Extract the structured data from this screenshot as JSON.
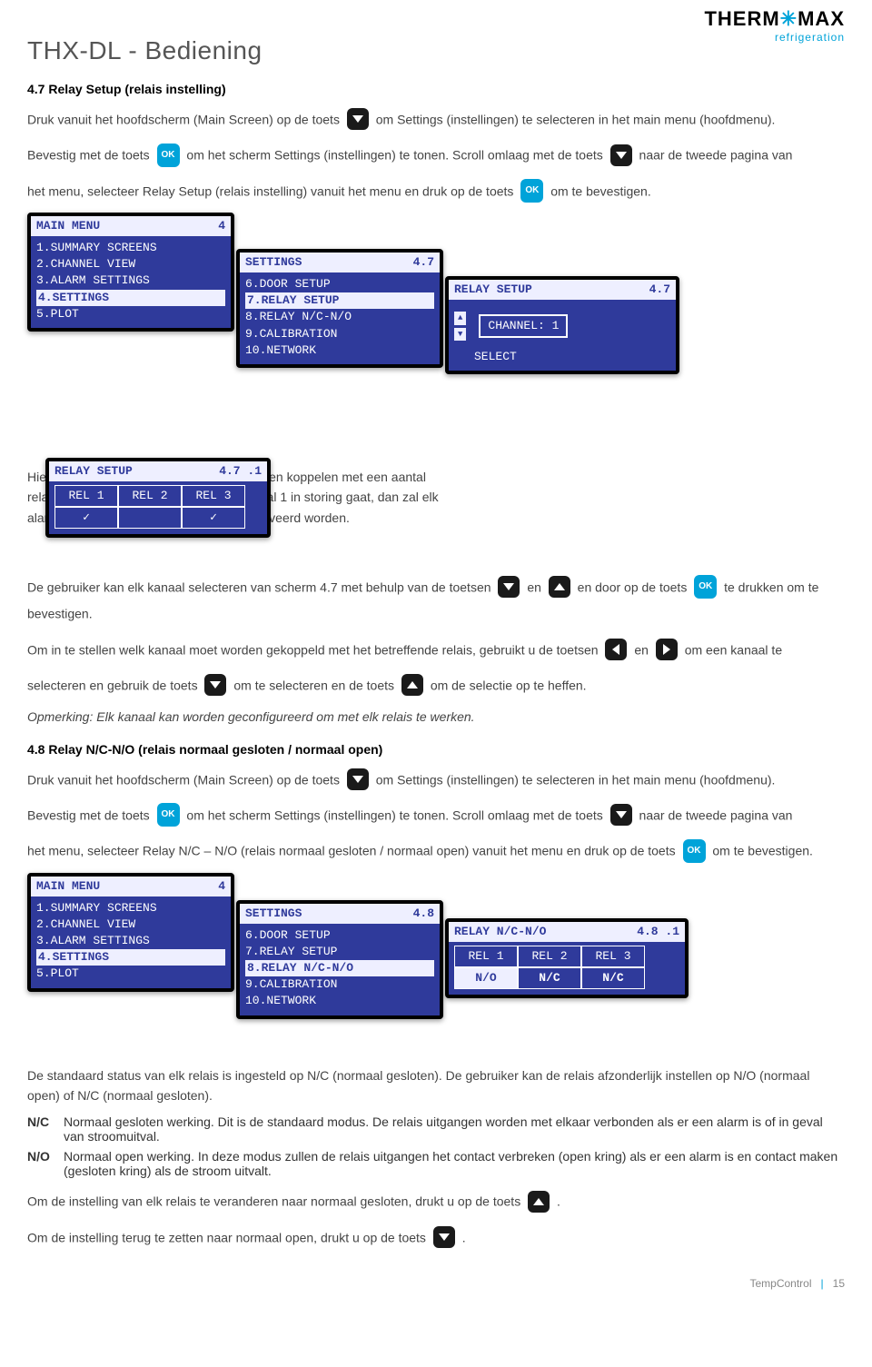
{
  "brand": {
    "name_a": "THERM",
    "name_b": "MAX",
    "sub": "refrigeration"
  },
  "page_title": "THX-DL - Bediening",
  "s47": {
    "heading": "4.7  Relay Setup (relais instelling)",
    "l1a": "Druk vanuit het hoofdscherm (Main Screen) op de toets",
    "l1b": "om Settings (instellingen) te selecteren in het main menu (hoofdmenu).",
    "l2a": "Bevestig met de toets",
    "l2b": "om het scherm Settings (instellingen) te tonen. Scroll omlaag met de toets",
    "l2c": "naar de tweede pagina van",
    "l3a": "het menu, selecteer Relay Setup (relais instelling) vanuit het menu en druk op de toets",
    "l3b": "om te bevestigen.",
    "koppel": "Hiermee kan de gebruiker elk van de kanalen koppelen met een aantal relais uitgangen, bijv. alarmrelais. Als kanaal 1 in storing gaat, dan zal elk alarm dat is gekoppeld met kanaal 1 geactiveerd worden.",
    "p4a": "De gebruiker kan elk kanaal selecteren van scherm 4.7 met behulp van de toetsen",
    "p4b": "en",
    "p4c": "en door op de toets",
    "p4d": "te drukken om te bevestigen.",
    "p5a": "Om in te stellen welk kanaal moet worden gekoppeld met het betreffende relais, gebruikt u de toetsen",
    "p5b": "en",
    "p5c": "om een kanaal te",
    "p6a": "selecteren en gebruik de toets",
    "p6b": "om te selecteren en de toets",
    "p6c": "om de selectie op te heffen.",
    "note": "Opmerking: Elk kanaal kan worden geconfigureerd om met elk relais te werken."
  },
  "s48": {
    "heading": "4.8  Relay N/C-N/O (relais normaal gesloten / normaal open)",
    "l1a": "Druk vanuit het hoofdscherm (Main Screen) op de toets",
    "l1b": "om Settings (instellingen) te selecteren in het main menu (hoofdmenu).",
    "l2a": "Bevestig met de toets",
    "l2b": "om het scherm Settings (instellingen) te tonen. Scroll omlaag met de toets",
    "l2c": "naar de tweede pagina van",
    "l3a": "het menu, selecteer Relay N/C – N/O (relais normaal gesloten / normaal open) vanuit het menu en druk op de toets",
    "l3b": "om te bevestigen.",
    "std": "De standaard status van elk relais is ingesteld op N/C (normaal gesloten). De gebruiker kan de relais afzonderlijk instellen op N/O (normaal open) of N/C (normaal gesloten).",
    "nc_label": "N/C",
    "nc": "Normaal gesloten werking. Dit is de standaard modus. De relais uitgangen worden met elkaar verbonden als er een alarm is of in geval van stroomuitval.",
    "no_label": "N/O",
    "no": "Normaal open werking. In deze modus zullen de relais uitgangen het contact verbreken (open kring) als er een alarm is en contact maken (gesloten kring) als de stroom uitvalt.",
    "chg_up": "Om de instelling van elk relais te veranderen naar normaal gesloten, drukt u op de toets",
    "chg_dn": "Om de instelling terug te zetten naar normaal open, drukt u op de toets",
    "dot": "."
  },
  "lcd_main": {
    "title": "MAIN MENU",
    "page": "4",
    "items": [
      "1.SUMMARY SCREENS",
      "2.CHANNEL VIEW",
      "3.ALARM SETTINGS",
      "4.SETTINGS",
      "5.PLOT"
    ],
    "hl": 3
  },
  "lcd_settings47": {
    "title": "SETTINGS",
    "page": "4.7",
    "items": [
      "6.DOOR SETUP",
      "7.RELAY SETUP",
      "8.RELAY N/C-N/O",
      "9.CALIBRATION",
      "10.NETWORK"
    ],
    "hl": 1
  },
  "lcd_relay": {
    "title": "RELAY SETUP",
    "page": "4.7",
    "channel_label": "CHANNEL:",
    "channel_val": "1",
    "select": "SELECT"
  },
  "lcd_relay471": {
    "title": "RELAY SETUP",
    "page": "4.7 .1",
    "cols": [
      "REL  1",
      "REL  2",
      "REL  3"
    ],
    "vals": [
      "✓",
      "",
      "✓"
    ]
  },
  "lcd_settings48": {
    "title": "SETTINGS",
    "page": "4.8",
    "items": [
      "6.DOOR SETUP",
      "7.RELAY SETUP",
      "8.RELAY N/C-N/O",
      "9.CALIBRATION",
      "10.NETWORK"
    ],
    "hl": 2
  },
  "lcd_ncno": {
    "title": "RELAY N/C-N/O",
    "page": "4.8 .1",
    "cols": [
      "REL  1",
      "REL  2",
      "REL  3"
    ],
    "vals": [
      "N/O",
      "N/C",
      "N/C"
    ]
  },
  "footer": {
    "product": "TempControl",
    "page": "15"
  },
  "ok": "OK"
}
